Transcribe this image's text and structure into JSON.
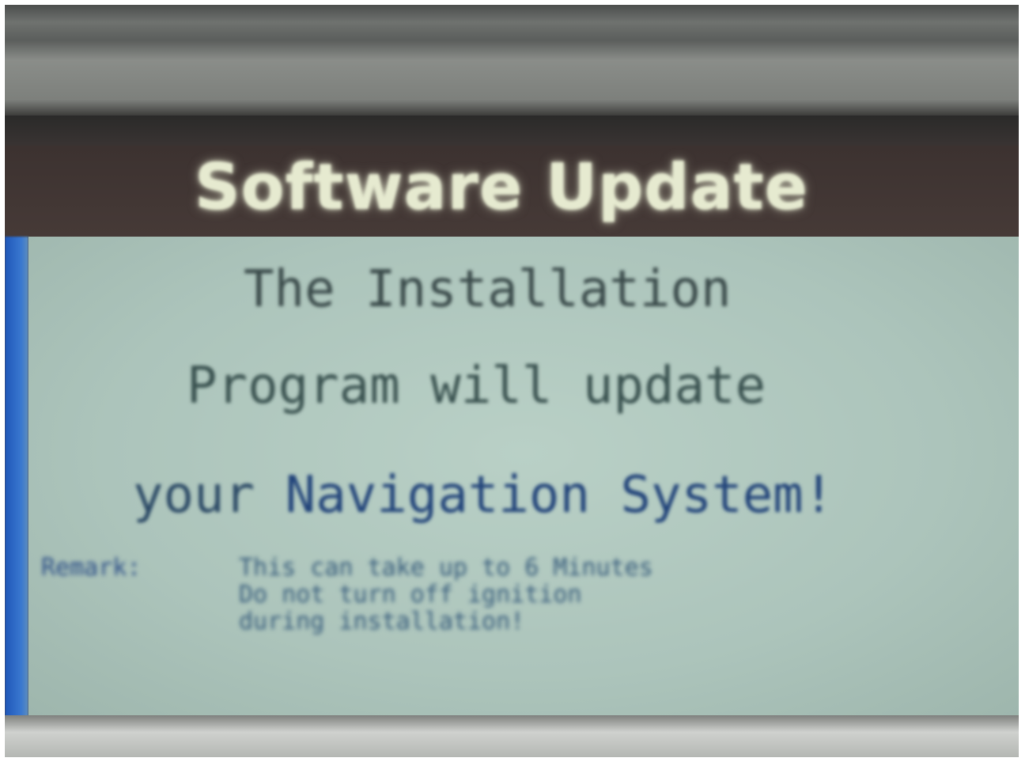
{
  "screen": {
    "title": "Software Update",
    "message": {
      "line1": "The Installation",
      "line2": "Program will update",
      "line3_prefix": "your ",
      "line3_highlight": "Navigation System!"
    },
    "remark": {
      "label": "Remark:",
      "lines": [
        "This can take up to 6 Minutes",
        "Do not turn off ignition",
        "during installation!"
      ]
    }
  },
  "colors": {
    "title_bar": "#3f3633",
    "title_text": "#e6ead0",
    "content_bg": "#b0c8bf",
    "accent_edge": "#2f6cc8",
    "remark_text": "#355a7a"
  }
}
